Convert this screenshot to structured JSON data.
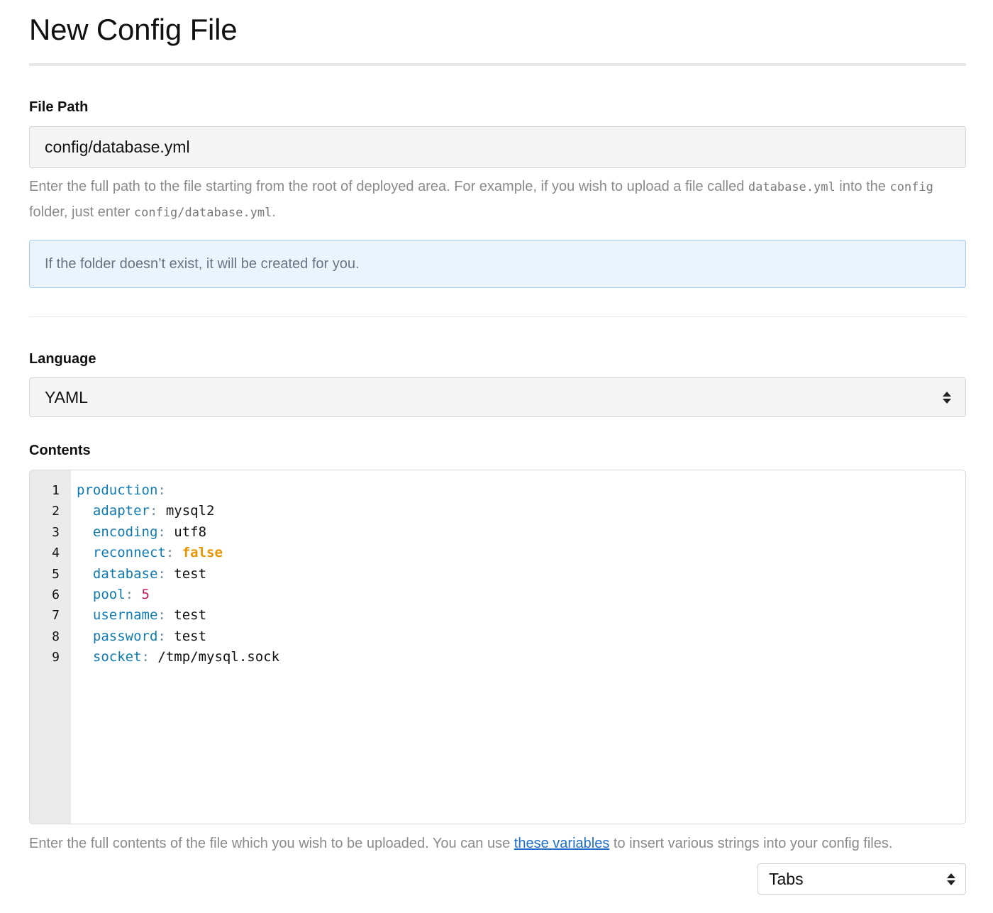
{
  "page": {
    "title": "New Config File"
  },
  "file_path": {
    "label": "File Path",
    "value": "config/database.yml",
    "help_part1": "Enter the full path to the file starting from the root of deployed area. For example, if you wish to upload a file called ",
    "help_code1": "database.yml",
    "help_part2": " into the ",
    "help_code2": "config",
    "help_part3": " folder, just enter ",
    "help_code3": "config/database.yml",
    "help_part4": "."
  },
  "info": {
    "message": "If the folder doesn’t exist, it will be created for you."
  },
  "language": {
    "label": "Language",
    "selected": "YAML"
  },
  "contents": {
    "label": "Contents",
    "line_numbers": [
      "1",
      "2",
      "3",
      "4",
      "5",
      "6",
      "7",
      "8",
      "9"
    ],
    "lines": [
      {
        "indent": "",
        "key": "production",
        "colon": ":",
        "value": "",
        "type": "none"
      },
      {
        "indent": "  ",
        "key": "adapter",
        "colon": ":",
        "value": " mysql2",
        "type": "str"
      },
      {
        "indent": "  ",
        "key": "encoding",
        "colon": ":",
        "value": " utf8",
        "type": "str"
      },
      {
        "indent": "  ",
        "key": "reconnect",
        "colon": ":",
        "value": " false",
        "type": "bool"
      },
      {
        "indent": "  ",
        "key": "database",
        "colon": ":",
        "value": " test",
        "type": "str"
      },
      {
        "indent": "  ",
        "key": "pool",
        "colon": ":",
        "value": " 5",
        "type": "num"
      },
      {
        "indent": "  ",
        "key": "username",
        "colon": ":",
        "value": " test",
        "type": "str"
      },
      {
        "indent": "  ",
        "key": "password",
        "colon": ":",
        "value": " test",
        "type": "str"
      },
      {
        "indent": "  ",
        "key": "socket",
        "colon": ":",
        "value": " /tmp/mysql.sock",
        "type": "str"
      }
    ],
    "help_before": "Enter the full contents of the file which you wish to be uploaded. You can use ",
    "help_link": "these variables",
    "help_after": " to insert various strings into your config files."
  },
  "indentation": {
    "selected": "Tabs"
  },
  "icons": {
    "select_arrow": "updown-arrows-icon"
  },
  "colors": {
    "yaml_key": "#0f7bb3",
    "yaml_bool": "#e89400",
    "yaml_number": "#c2185b",
    "link": "#1f6fc9",
    "info_bg": "#ebf3fe",
    "info_border": "#a9ccef"
  }
}
